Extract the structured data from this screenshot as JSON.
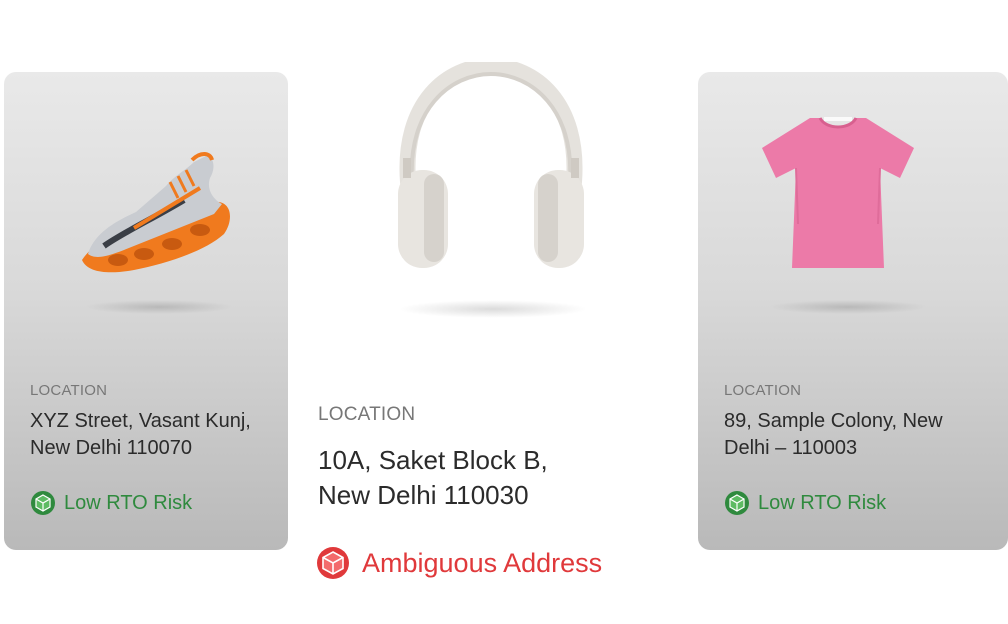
{
  "cards": [
    {
      "product": "sneaker",
      "location_label": "LOCATION",
      "address_line1": "XYZ Street, Vasant Kunj,",
      "address_line2": "New Delhi 110070",
      "risk_label": "Low RTO Risk",
      "risk_color": "#2f8a3e",
      "icon": "green-box-icon"
    },
    {
      "product": "headphones",
      "location_label": "LOCATION",
      "address_line1": "10A, Saket Block B,",
      "address_line2": "New Delhi 110030",
      "risk_label": "Ambiguous Address",
      "risk_color": "#e0393b",
      "icon": "red-box-icon"
    },
    {
      "product": "t-shirt",
      "location_label": "LOCATION",
      "address_line1": "89, Sample Colony, New",
      "address_line2": "Delhi – 110003",
      "risk_label": "Low RTO Risk",
      "risk_color": "#2f8a3e",
      "icon": "green-box-icon"
    }
  ]
}
